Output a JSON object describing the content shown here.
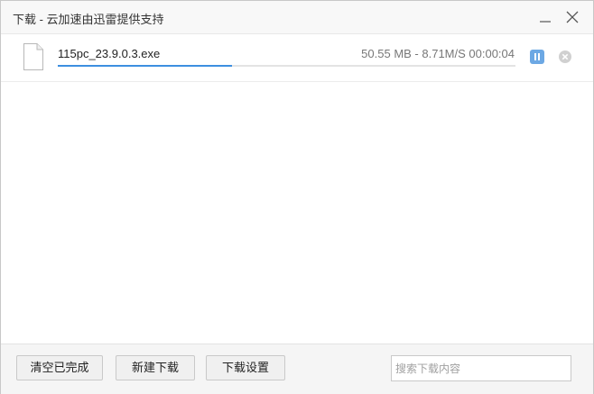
{
  "window": {
    "title": "下载 - 云加速由迅雷提供支持"
  },
  "colors": {
    "accent": "#3d8fe0",
    "pause_button": "#6ca8e4",
    "titlebar_bg": "#f8f8f8",
    "footer_bg": "#f5f5f5"
  },
  "icons": {
    "minimize": "minimize-icon",
    "close": "close-icon",
    "file": "file-icon",
    "pause": "pause-icon",
    "cancel": "cancel-circle-icon"
  },
  "downloads": [
    {
      "filename": "115pc_23.9.0.3.exe",
      "stats": "50.55 MB - 8.71M/S 00:00:04",
      "progress_fraction": 0.38
    }
  ],
  "footer": {
    "clear_completed_label": "清空已完成",
    "new_download_label": "新建下载",
    "download_settings_label": "下载设置",
    "search_placeholder": "搜索下载内容",
    "search_value": ""
  }
}
